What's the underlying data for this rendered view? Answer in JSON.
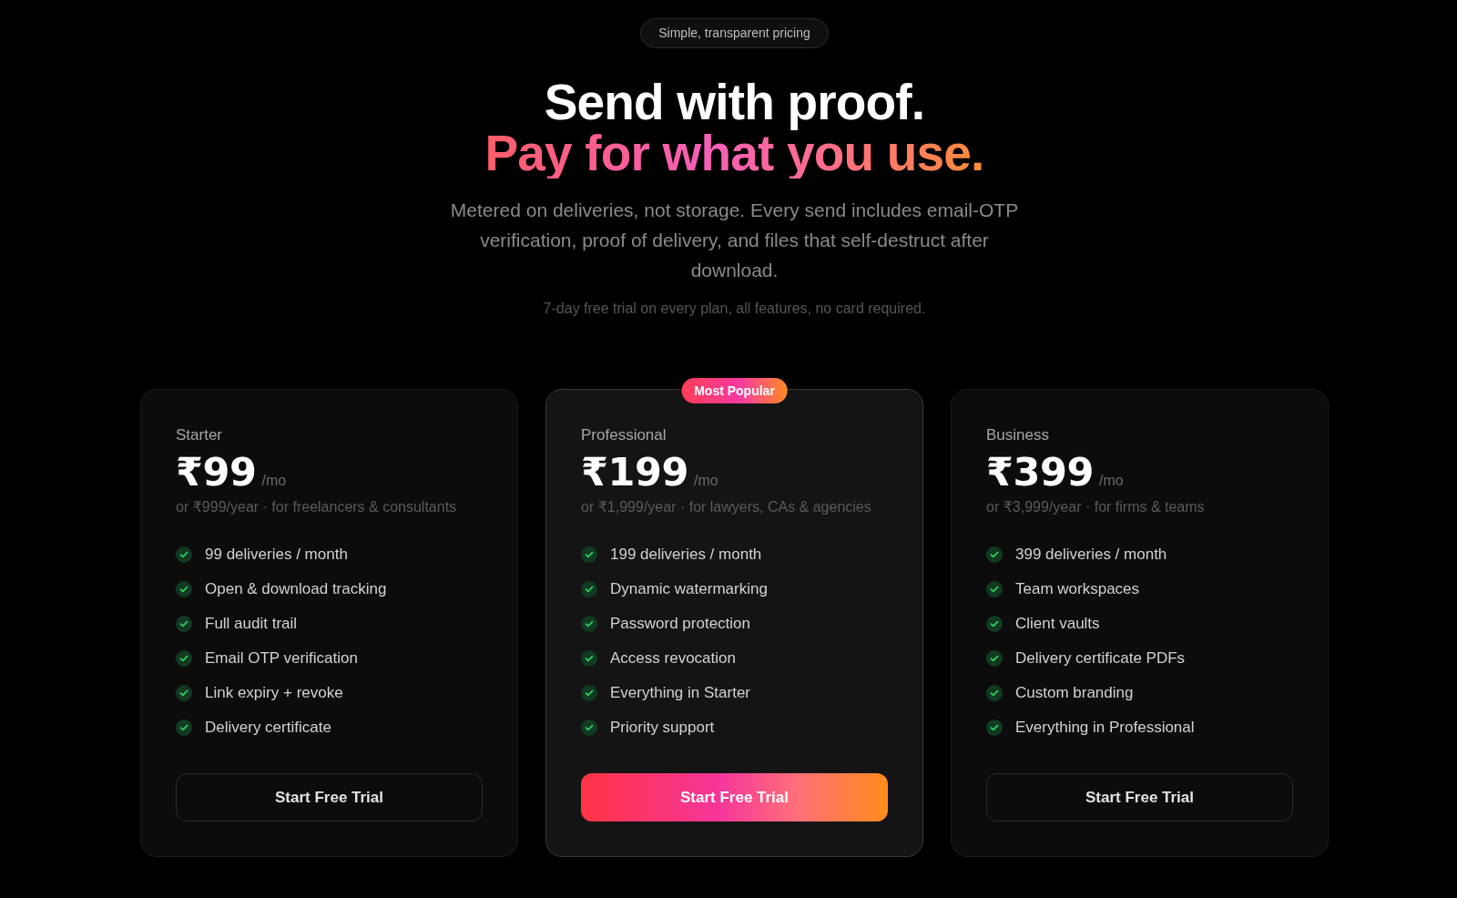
{
  "header": {
    "badge": "Simple, transparent pricing",
    "title_line_1": "Send with proof.",
    "title_line_2": "Pay for what you use.",
    "description": "Metered on deliveries, not storage. Every send includes email-OTP verification, proof of delivery, and files that self-destruct after download.",
    "note": "7-day free trial on every plan, all features, no card required."
  },
  "plans": [
    {
      "name": "Starter",
      "price": "₹99",
      "period": "/mo",
      "subtitle": "or ₹999/year · for freelancers & consultants",
      "featured": false,
      "features": [
        "99 deliveries / month",
        "Open & download tracking",
        "Full audit trail",
        "Email OTP verification",
        "Link expiry + revoke",
        "Delivery certificate"
      ],
      "button": "Start Free Trial"
    },
    {
      "name": "Professional",
      "badge": "Most Popular",
      "price": "₹199",
      "period": "/mo",
      "subtitle": "or ₹1,999/year · for lawyers, CAs & agencies",
      "featured": true,
      "features": [
        "199 deliveries / month",
        "Dynamic watermarking",
        "Password protection",
        "Access revocation",
        "Everything in Starter",
        "Priority support"
      ],
      "button": "Start Free Trial"
    },
    {
      "name": "Business",
      "price": "₹399",
      "period": "/mo",
      "subtitle": "or ₹3,999/year · for firms & teams",
      "featured": false,
      "features": [
        "399 deliveries / month",
        "Team workspaces",
        "Client vaults",
        "Delivery certificate PDFs",
        "Custom branding",
        "Everything in Professional"
      ],
      "button": "Start Free Trial"
    }
  ]
}
